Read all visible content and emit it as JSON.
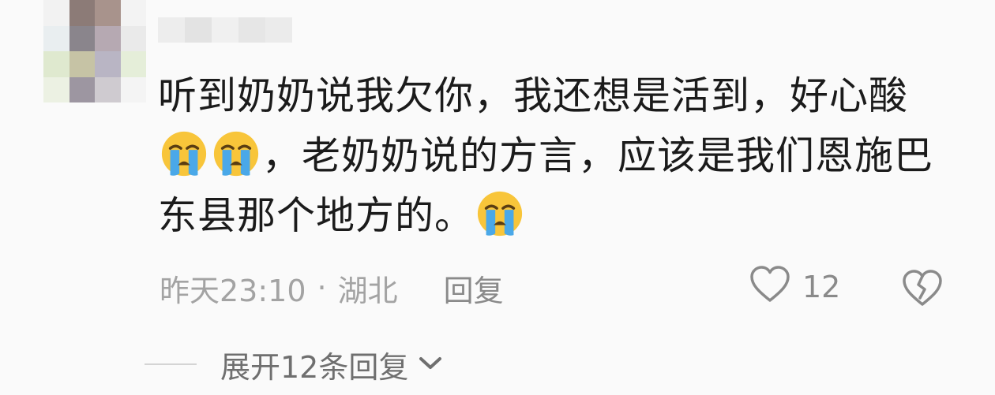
{
  "comment": {
    "segments": [
      {
        "type": "text",
        "value": "听到奶奶说我欠你，我还想是活到，好心酸"
      },
      {
        "type": "emoji",
        "name": "loudly-crying-face"
      },
      {
        "type": "emoji",
        "name": "loudly-crying-face"
      },
      {
        "type": "text",
        "value": "，老奶奶说的方言，应该是我们恩施巴东县那个地方的。"
      },
      {
        "type": "emoji",
        "name": "loudly-crying-face"
      }
    ]
  },
  "meta": {
    "time": "昨天23:10",
    "separator": "·",
    "location": "湖北",
    "reply_label": "回复"
  },
  "actions": {
    "like_icon": "heart-outline-icon",
    "like_count": "12",
    "dislike_icon": "broken-heart-icon"
  },
  "expand": {
    "label": "展开12条回复",
    "icon": "chevron-down-icon"
  },
  "colors": {
    "text": "#1b1b1b",
    "meta": "#a3a3a3",
    "icon": "#8a8a8a",
    "emoji_face": "#f8c53a",
    "emoji_tears": "#4aa8e8"
  }
}
